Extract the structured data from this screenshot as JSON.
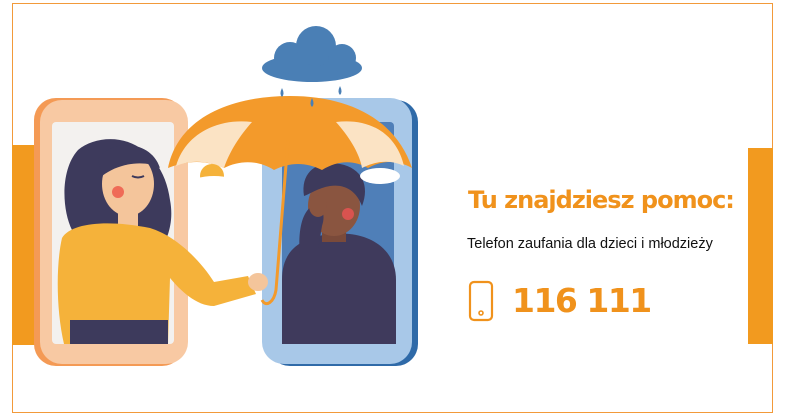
{
  "headline": "Tu znajdziesz pomoc:",
  "subtitle": "Telefon zaufania dla dzieci i młodzieży",
  "phone_number": "116 111",
  "icon": "smartphone-icon",
  "colors": {
    "accent": "#f0921c",
    "border": "#f29a3a",
    "phone_left": "#f8c9a3",
    "phone_right": "#a8c8e8",
    "sweater": "#f5b23a",
    "hoodie": "#3f3a5c",
    "cloud": "#4a7fb5"
  }
}
